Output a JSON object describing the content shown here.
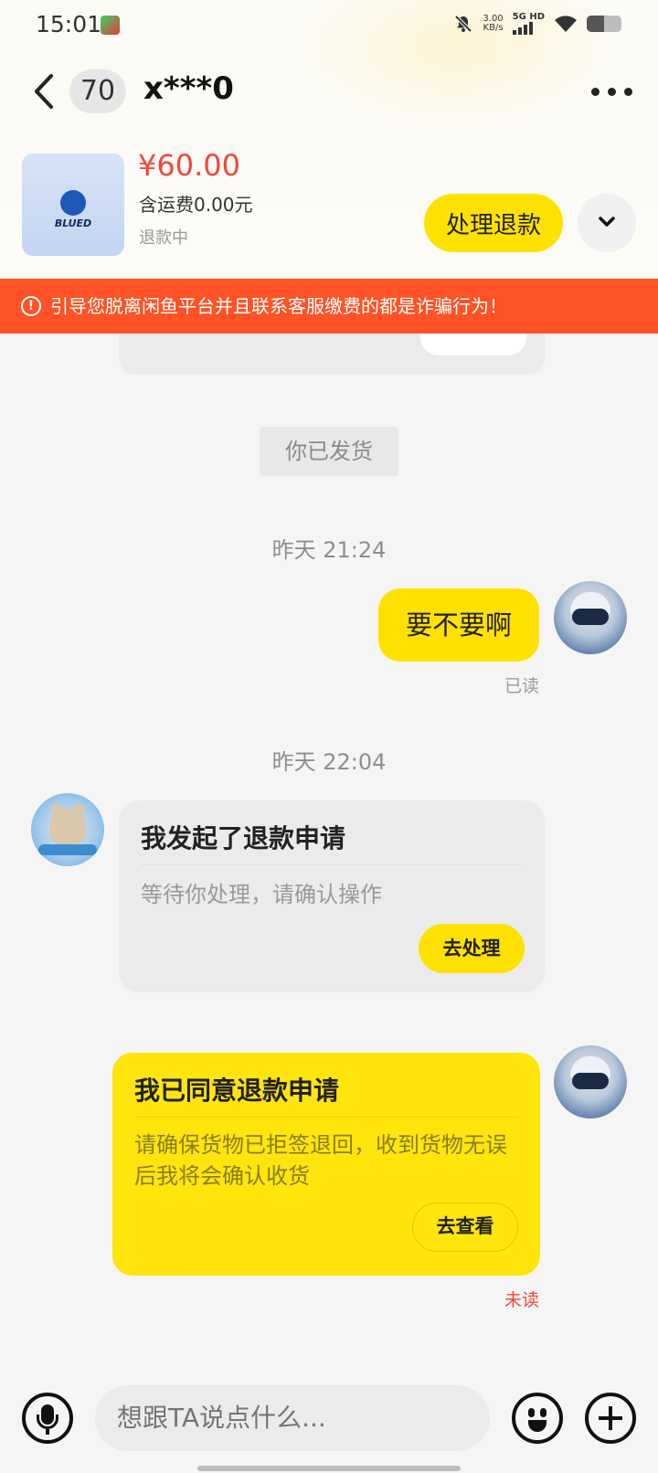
{
  "status_bar": {
    "time": "15:01",
    "net_speed": "3.00",
    "net_unit": "KB/s",
    "signal_label": "5G HD",
    "battery_level": 0.5
  },
  "header": {
    "unread_count": "70",
    "username": "x***0"
  },
  "product": {
    "thumb_text": "BLUED",
    "price": "¥60.00",
    "shipping": "含运费0.00元",
    "status": "退款中",
    "refund_button": "处理退款"
  },
  "warning": {
    "text": "引导您脱离闲鱼平台并且联系客服缴费的都是诈骗行为！"
  },
  "chat": {
    "system_shipped": "你已发货",
    "time_1": "昨天 21:24",
    "message_1": "要不要啊",
    "message_1_status": "已读",
    "time_2": "昨天 22:04",
    "refund_request_card": {
      "title": "我发起了退款申请",
      "desc": "等待你处理，请确认操作",
      "button": "去处理"
    },
    "refund_agree_card": {
      "title": "我已同意退款申请",
      "desc": "请确保货物已拒签退回，收到货物无误后我将会确认收货",
      "button": "去查看",
      "status": "未读"
    }
  },
  "input_bar": {
    "placeholder": "想跟TA说点什么..."
  },
  "colors": {
    "accent_yellow": "#ffe100",
    "warning_red": "#ff5226",
    "price_red": "#f0473a",
    "unread_red": "#f0473a"
  }
}
